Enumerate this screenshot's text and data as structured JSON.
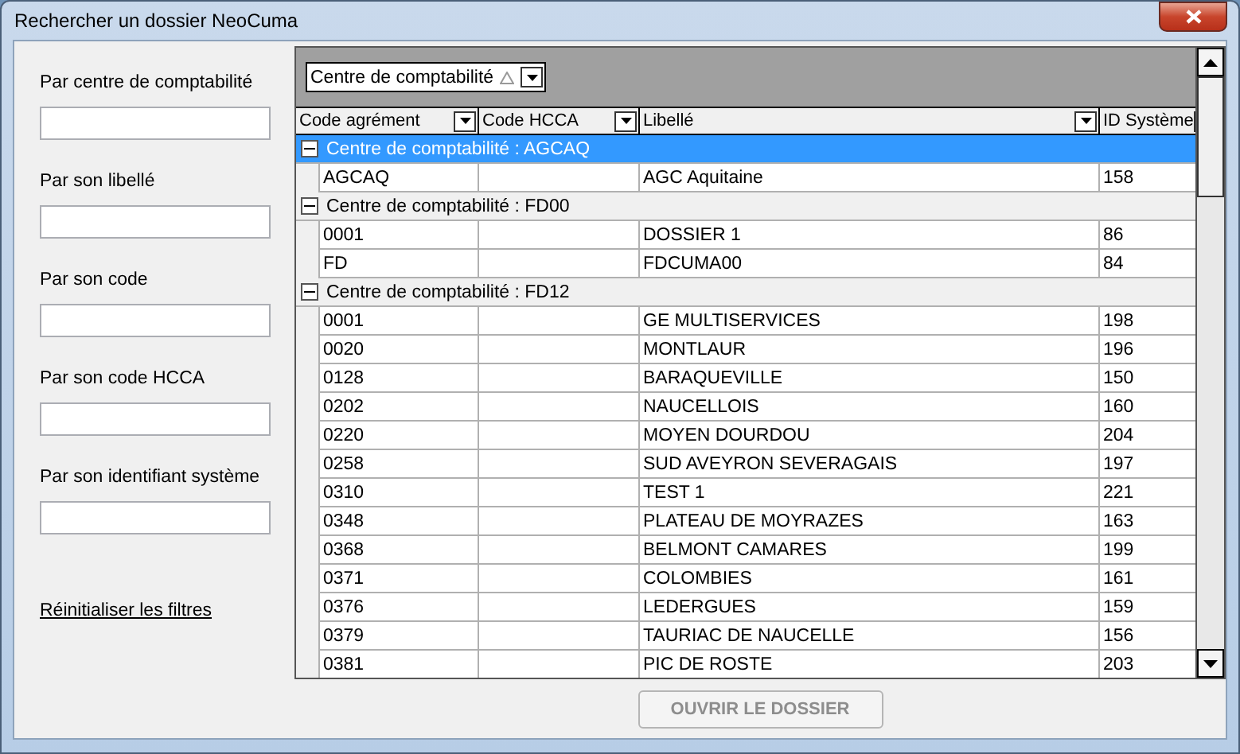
{
  "window": {
    "title": "Rechercher un dossier NeoCuma"
  },
  "filters": [
    {
      "label": "Par centre de comptabilité"
    },
    {
      "label": "Par son libellé"
    },
    {
      "label": "Par son code"
    },
    {
      "label": "Par son code HCCA"
    },
    {
      "label": "Par son identifiant système"
    }
  ],
  "reset_link": "Réinitialiser les filtres",
  "group_by": {
    "label": "Centre de comptabilité"
  },
  "columns": [
    "Code agrément",
    "Code HCCA",
    "Libellé",
    "ID Système"
  ],
  "groups": [
    {
      "label": "Centre de comptabilité : AGCAQ",
      "expanded": true,
      "selected": true,
      "rows": [
        {
          "code": "AGCAQ",
          "libelle": "AGC Aquitaine",
          "id": "158"
        }
      ]
    },
    {
      "label": "Centre de comptabilité : FD00",
      "expanded": true,
      "selected": false,
      "rows": [
        {
          "code": "0001",
          "libelle": "DOSSIER 1",
          "id": "86"
        },
        {
          "code": "FD",
          "libelle": "FDCUMA00",
          "id": "84"
        }
      ]
    },
    {
      "label": "Centre de comptabilité : FD12",
      "expanded": true,
      "selected": false,
      "rows": [
        {
          "code": "0001",
          "libelle": "GE MULTISERVICES",
          "id": "198"
        },
        {
          "code": "0020",
          "libelle": "MONTLAUR",
          "id": "196"
        },
        {
          "code": "0128",
          "libelle": "BARAQUEVILLE",
          "id": "150"
        },
        {
          "code": "0202",
          "libelle": "NAUCELLOIS",
          "id": "160"
        },
        {
          "code": "0220",
          "libelle": "MOYEN DOURDOU",
          "id": "204"
        },
        {
          "code": "0258",
          "libelle": "SUD AVEYRON SEVERAGAIS",
          "id": "197"
        },
        {
          "code": "0310",
          "libelle": "TEST 1",
          "id": "221"
        },
        {
          "code": "0348",
          "libelle": "PLATEAU DE MOYRAZES",
          "id": "163"
        },
        {
          "code": "0368",
          "libelle": "BELMONT CAMARES",
          "id": "199"
        },
        {
          "code": "0371",
          "libelle": "COLOMBIES",
          "id": "161"
        },
        {
          "code": "0376",
          "libelle": "LEDERGUES",
          "id": "159"
        },
        {
          "code": "0379",
          "libelle": "TAURIAC DE NAUCELLE",
          "id": "156"
        },
        {
          "code": "0381",
          "libelle": "PIC DE ROSTE",
          "id": "203"
        }
      ]
    }
  ],
  "open_button": {
    "label": "OUVRIR LE DOSSIER",
    "disabled": true
  }
}
